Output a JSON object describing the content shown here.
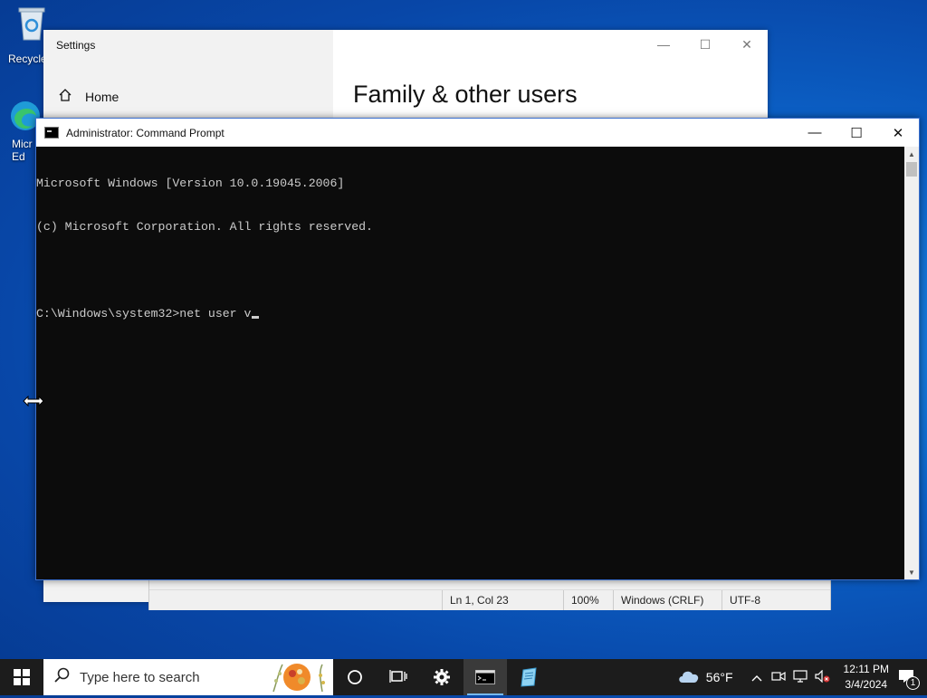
{
  "desktop": {
    "recycle_bin_label": "Recycle",
    "edge_label_line1": "Micr",
    "edge_label_line2": "Ed"
  },
  "settings": {
    "title": "Settings",
    "home_label": "Home",
    "heading": "Family & other users"
  },
  "notepad": {
    "position": "Ln 1, Col 23",
    "zoom": "100%",
    "line_ending": "Windows (CRLF)",
    "encoding": "UTF-8"
  },
  "cmd": {
    "title": "Administrator: Command Prompt",
    "lines": [
      "Microsoft Windows [Version 10.0.19045.2006]",
      "(c) Microsoft Corporation. All rights reserved.",
      "",
      "C:\\Windows\\system32>net user v"
    ]
  },
  "taskbar": {
    "search_placeholder": "Type here to search",
    "weather_temp": "56°F",
    "time": "12:11 PM",
    "date": "3/4/2024",
    "notification_count": "1"
  },
  "colors": {
    "console_bg": "#0c0c0c",
    "console_fg": "#cccccc",
    "taskbar_bg": "#1c1c1c",
    "accent": "#76b9ed"
  }
}
